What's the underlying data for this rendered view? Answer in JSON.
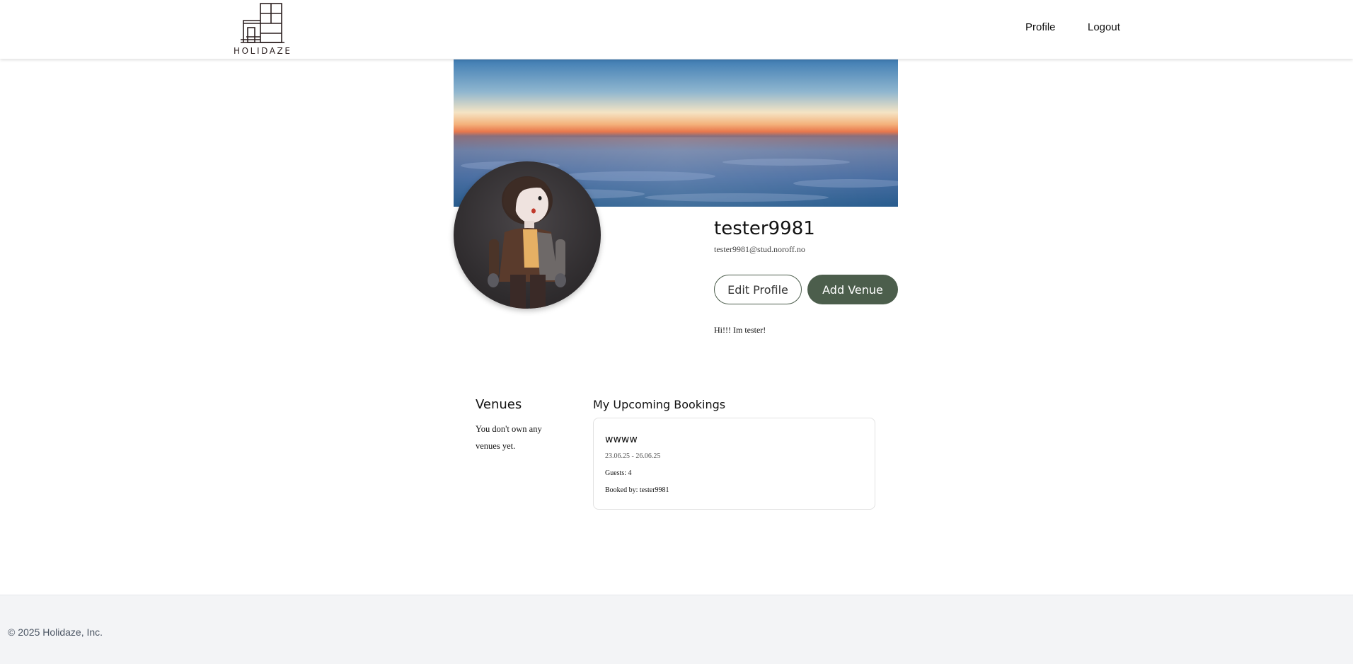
{
  "header": {
    "logo_text": "HOLIDAZE",
    "nav": {
      "profile": "Profile",
      "logout": "Logout"
    }
  },
  "profile": {
    "username": "tester9981",
    "email": "tester9981@stud.noroff.no",
    "bio": "Hi!!! Im tester!",
    "buttons": {
      "edit": "Edit Profile",
      "add_venue": "Add Venue"
    }
  },
  "venues": {
    "title": "Venues",
    "empty_text": "You don't own any venues yet."
  },
  "bookings": {
    "title": "My Upcoming Bookings",
    "items": [
      {
        "name": "wwww",
        "dates": "23.06.25 - 26.06.25",
        "guests": "Guests: 4",
        "booked_by": "Booked by: tester9981"
      }
    ]
  },
  "footer": {
    "copyright": "© 2025 Holidaze, Inc."
  },
  "colors": {
    "accent": "#4c5e4c",
    "footer_bg": "#f3f4f6",
    "text": "#111111"
  },
  "icons": {
    "logo": "building-logo-icon"
  }
}
